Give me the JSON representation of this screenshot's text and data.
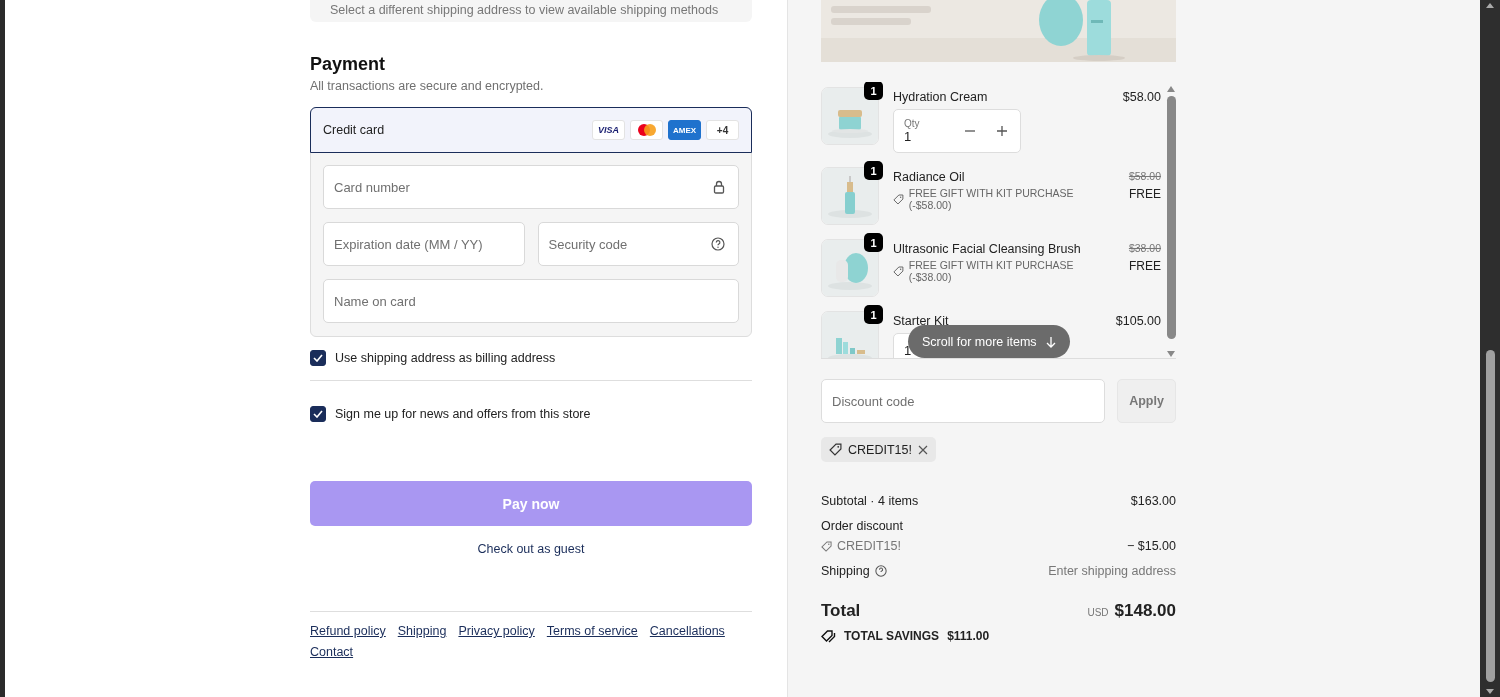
{
  "shipping_notice": "Select a different shipping address to view available shipping methods",
  "payment": {
    "title": "Payment",
    "subtitle": "All transactions are secure and encrypted.",
    "method": {
      "label": "Credit card",
      "selected": true
    },
    "brands": [
      {
        "kind": "visa",
        "label": "VISA"
      },
      {
        "kind": "mastercard"
      },
      {
        "kind": "amex",
        "label": "AMEX"
      },
      {
        "kind": "more",
        "label": "+4"
      }
    ],
    "fields": [
      {
        "kind": "card_number",
        "placeholder": "Card number"
      },
      {
        "kind": "expiry",
        "placeholder": "Expiration date (MM / YY)"
      },
      {
        "kind": "security_code",
        "placeholder": "Security code"
      },
      {
        "kind": "name",
        "placeholder": "Name on card"
      }
    ]
  },
  "checkboxes": [
    {
      "label": "Use shipping address as billing address",
      "checked": true
    },
    {
      "label": "Sign me up for news and offers from this store",
      "checked": true
    }
  ],
  "pay_button": {
    "label": "Pay now",
    "disabled": true
  },
  "guest_link": "Check out as guest",
  "footer_links": [
    "Refund policy",
    "Shipping",
    "Privacy policy",
    "Terms of service",
    "Cancellations",
    "Contact"
  ],
  "order": {
    "items": [
      {
        "name": "Hydration Cream",
        "badge": "1",
        "price": "$58.00",
        "qty": {
          "label": "Qty",
          "value": "1"
        }
      },
      {
        "name": "Radiance Oil",
        "badge": "1",
        "original_price": "$58.00",
        "price": "FREE",
        "note": "FREE GIFT WITH KIT PURCHASE (-$58.00)"
      },
      {
        "name": "Ultrasonic Facial Cleansing Brush",
        "badge": "1",
        "original_price": "$38.00",
        "price": "FREE",
        "note": "FREE GIFT WITH KIT PURCHASE (-$38.00)"
      },
      {
        "name": "Starter Kit",
        "badge": "1",
        "price": "$105.00",
        "qty": {
          "value": "1"
        }
      }
    ],
    "scroll_hint": "Scroll for more items",
    "discount": {
      "placeholder": "Discount code",
      "button": "Apply"
    },
    "applied_code": "CREDIT15!",
    "summary": {
      "subtotal_label": "Subtotal · 4 items",
      "subtotal": "$163.00",
      "discount_label": "Order discount",
      "discount_code": "CREDIT15!",
      "discount": "− $15.00",
      "shipping_label": "Shipping",
      "shipping": "Enter shipping address",
      "total_label": "Total",
      "currency": "USD",
      "total": "$148.00",
      "savings_label": "TOTAL SAVINGS",
      "savings": "$111.00"
    }
  }
}
